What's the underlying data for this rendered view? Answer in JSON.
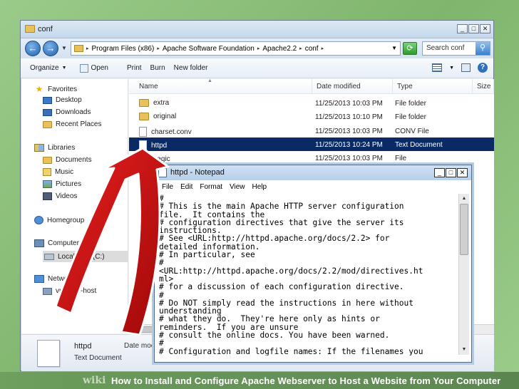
{
  "explorer": {
    "title": "conf",
    "breadcrumb": [
      "Program Files (x86)",
      "Apache Software Foundation",
      "Apache2.2",
      "conf"
    ],
    "search_placeholder": "Search conf",
    "toolbar": {
      "organize": "Organize",
      "open": "Open",
      "print": "Print",
      "burn": "Burn",
      "new_folder": "New folder"
    },
    "nav": {
      "favorites": "Favorites",
      "desktop": "Desktop",
      "downloads": "Downloads",
      "recent_places": "Recent Places",
      "libraries": "Libraries",
      "documents": "Documents",
      "music": "Music",
      "pictures": "Pictures",
      "videos": "Videos",
      "homegroup": "Homegroup",
      "computer": "Computer",
      "local_disk": "Local Disk (C:)",
      "network": "Network",
      "vmware_host": "vmware-host"
    },
    "columns": {
      "name": "Name",
      "date": "Date modified",
      "type": "Type",
      "size": "Size"
    },
    "files": [
      {
        "name": "extra",
        "date": "11/25/2013 10:03 PM",
        "type": "File folder",
        "icon": "folder-icon"
      },
      {
        "name": "original",
        "date": "11/25/2013 10:10 PM",
        "type": "File folder",
        "icon": "folder-icon"
      },
      {
        "name": "charset.conv",
        "date": "11/25/2013 10:03 PM",
        "type": "CONV File",
        "icon": "document-icon"
      },
      {
        "name": "httpd",
        "date": "11/25/2013 10:24 PM",
        "type": "Text Document",
        "icon": "document-icon",
        "selected": true
      },
      {
        "name": "magic",
        "date": "11/25/2013 10:03 PM",
        "type": "File",
        "icon": "document-icon"
      }
    ],
    "details": {
      "name": "httpd",
      "type": "Text Document",
      "date_label": "Date moc"
    }
  },
  "notepad": {
    "title": "httpd - Notepad",
    "menu": [
      "File",
      "Edit",
      "Format",
      "View",
      "Help"
    ],
    "lines": [
      "#",
      "# This is the main Apache HTTP server configuration",
      "file.  It contains the",
      "# configuration directives that give the server its",
      "instructions.",
      "# See <URL:http://httpd.apache.org/docs/2.2> for",
      "detailed information.",
      "# In particular, see",
      "#",
      "<URL:http://httpd.apache.org/docs/2.2/mod/directives.ht",
      "ml>",
      "# for a discussion of each configuration directive.",
      "#",
      "# Do NOT simply read the instructions in here without",
      "understanding",
      "# what they do.  They're here only as hints or",
      "reminders.  If you are unsure",
      "# consult the online docs. You have been warned.",
      "#",
      "# Configuration and logfile names: If the filenames you"
    ]
  },
  "caption": {
    "wiki": "wiki",
    "text": "How to Install and Configure Apache Webserver to Host a Website from Your Computer"
  },
  "colors": {
    "selection": "#0a2a66",
    "arrow": "#d01010",
    "background": "#8fc27c"
  }
}
